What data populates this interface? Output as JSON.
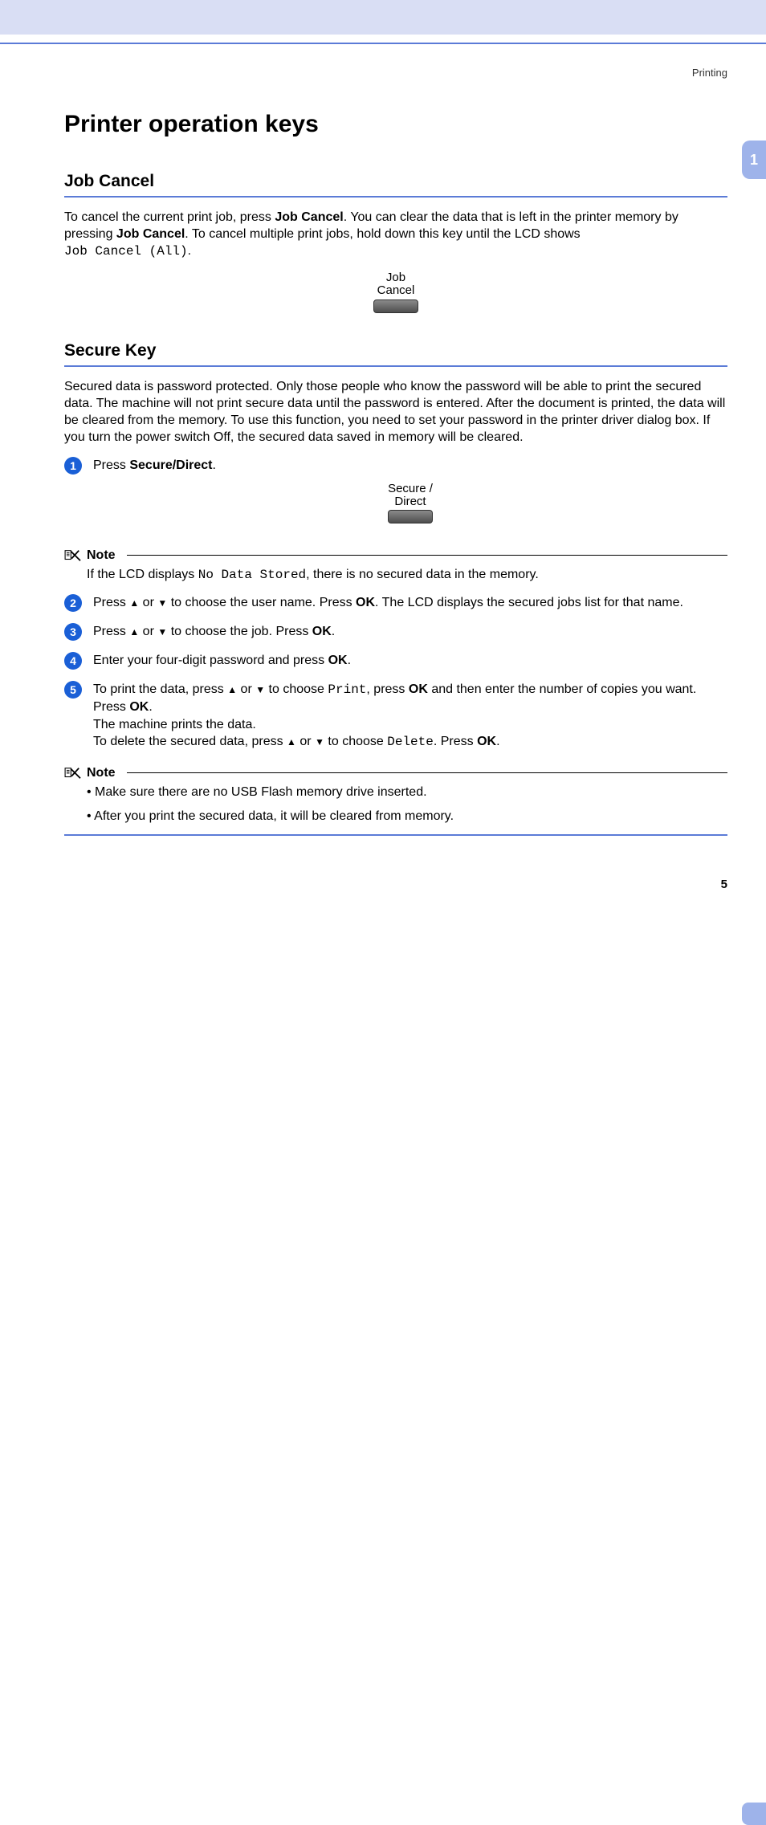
{
  "breadcrumb": "Printing",
  "chapter_tab": "1",
  "page_number": "5",
  "h1": "Printer operation keys",
  "job_cancel": {
    "heading": "Job Cancel",
    "para_part1": "To cancel the current print job, press ",
    "bold1": "Job Cancel",
    "para_part2": ". You can clear the data that is left in the printer memory by pressing ",
    "bold2": "Job Cancel",
    "para_part3": ". To cancel multiple print jobs, hold down this key until the LCD shows ",
    "mono": "Job Cancel (All)",
    "para_part4": ".",
    "button_label": "Job\nCancel"
  },
  "secure": {
    "heading": "Secure Key",
    "para": "Secured data is password protected. Only those people who know the password will be able to print the secured data. The machine will not print secure data until the password is entered. After the document is printed, the data will be cleared from the memory. To use this function, you need to set your password in the printer driver dialog box. If you turn the power switch Off, the secured data saved in memory will be cleared.",
    "button_label": "Secure /\nDirect",
    "step1_a": "Press ",
    "step1_b": "Secure/Direct",
    "step1_c": ".",
    "note1_title": "Note",
    "note1_a": "If the LCD displays ",
    "note1_mono": "No Data Stored",
    "note1_b": ", there is no secured data in the memory.",
    "step2_a": "Press ",
    "step2_up": "▲",
    "step2_or": " or ",
    "step2_dn": "▼",
    "step2_b": " to choose the user name. Press ",
    "step2_ok": "OK",
    "step2_c": ". The LCD displays the secured jobs list for that name.",
    "step3_a": "Press ",
    "step3_b": " to choose the job. Press ",
    "step3_ok": "OK",
    "step3_c": ".",
    "step4_a": "Enter your four-digit password and press ",
    "step4_ok": "OK",
    "step4_b": ".",
    "step5_a": "To print the data, press ",
    "step5_b": " to choose ",
    "step5_print": "Print",
    "step5_c": ", press ",
    "step5_ok1": "OK",
    "step5_d": " and then enter the number of copies you want. Press ",
    "step5_ok2": "OK",
    "step5_e": ".",
    "step5_line2": "The machine prints the data.",
    "step5_f": "To delete the secured data, press ",
    "step5_g": " to choose ",
    "step5_delete": "Delete",
    "step5_h": ". Press ",
    "step5_ok3": "OK",
    "step5_i": ".",
    "note2_title": "Note",
    "note2_item1": "Make sure there are no USB Flash memory drive inserted.",
    "note2_item2": "After you print the secured data, it will be cleared from memory."
  }
}
